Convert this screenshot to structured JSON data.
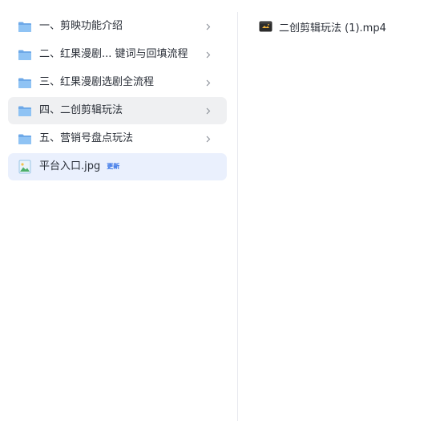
{
  "left_list": {
    "items": [
      {
        "label": "一、剪映功能介绍",
        "type": "folder",
        "state": "normal"
      },
      {
        "label": "二、红果漫剧... 键词与回填流程",
        "type": "folder",
        "state": "normal"
      },
      {
        "label": "三、红果漫剧选剧全流程",
        "type": "folder",
        "state": "normal"
      },
      {
        "label": "四、二创剪辑玩法",
        "type": "folder",
        "state": "hover"
      },
      {
        "label": "五、营销号盘点玩法",
        "type": "folder",
        "state": "normal"
      },
      {
        "label": "平台入口.jpg",
        "type": "image",
        "state": "selected",
        "badge": "更新"
      }
    ]
  },
  "right_list": {
    "items": [
      {
        "label": "二创剪辑玩法 (1).mp4",
        "type": "video"
      }
    ]
  },
  "colors": {
    "folder": "#7ab4ee",
    "hover_bg": "#eff0f2",
    "selected_bg": "#eaf0fd",
    "badge": "#2f6ee6"
  },
  "icons": {
    "folder": "folder-icon",
    "image": "image-file-icon",
    "video": "video-file-icon",
    "chevron": "chevron-right-icon"
  }
}
